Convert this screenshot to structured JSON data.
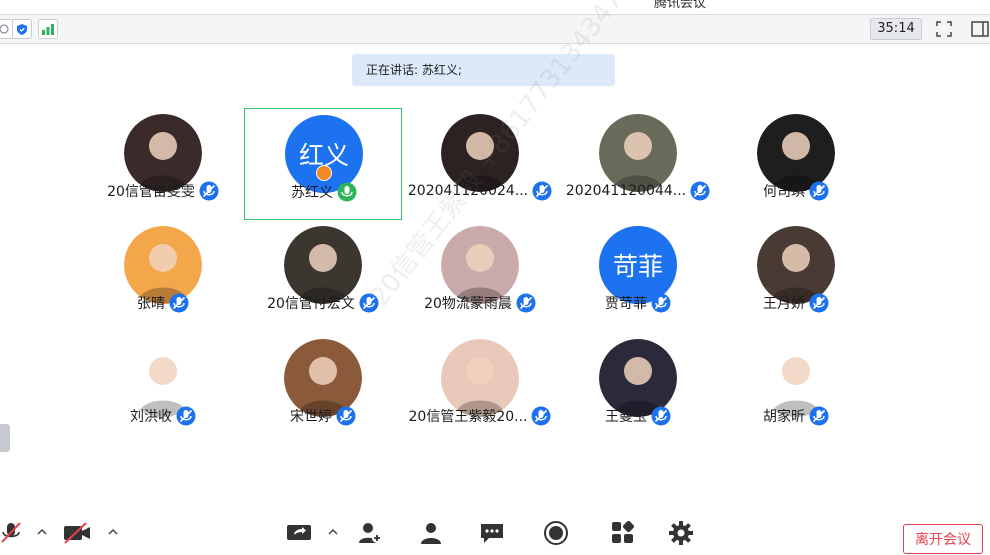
{
  "window": {
    "title": "腾讯会议"
  },
  "topbar": {
    "timer": "35:14"
  },
  "speaking_banner": {
    "text": "正在讲话: 苏红义;"
  },
  "participants": [
    {
      "name": "20信管苗雯雯",
      "avatar_type": "photo",
      "avatar_color": "#3a2a2a"
    },
    {
      "name": "苏红义",
      "avatar_type": "text",
      "avatar_text": "红义",
      "avatar_color": "#1d72f0",
      "speaking": true,
      "host": true
    },
    {
      "name": "202041120024...",
      "avatar_type": "photo",
      "avatar_color": "#2c2222"
    },
    {
      "name": "202041120044...",
      "avatar_type": "photo",
      "avatar_color": "#6a6a5a"
    },
    {
      "name": "何司琪",
      "avatar_type": "photo",
      "avatar_color": "#1e1e1e"
    },
    {
      "name": "张晴",
      "avatar_type": "photo",
      "avatar_color": "#f3a64a"
    },
    {
      "name": "20信管付宏文",
      "avatar_type": "photo",
      "avatar_color": "#3b3630"
    },
    {
      "name": "20物流蒙雨晨",
      "avatar_type": "photo",
      "avatar_color": "#c9a9a9"
    },
    {
      "name": "贾苛菲",
      "avatar_type": "text",
      "avatar_text": "苛菲",
      "avatar_color": "#1d72f0"
    },
    {
      "name": "王月娇",
      "avatar_type": "photo",
      "avatar_color": "#4a3a34"
    },
    {
      "name": "刘洪收",
      "avatar_type": "photo",
      "avatar_color": "#ffffff"
    },
    {
      "name": "宋世婷",
      "avatar_type": "photo",
      "avatar_color": "#8a5a3a"
    },
    {
      "name": "20信管王紫毅20...",
      "avatar_type": "photo",
      "avatar_color": "#e8c8b8"
    },
    {
      "name": "王曼玉",
      "avatar_type": "photo",
      "avatar_color": "#2a2a3a"
    },
    {
      "name": "胡家昕",
      "avatar_type": "photo",
      "avatar_color": "#ffffff"
    }
  ],
  "watermark": {
    "text": "20信管王紫毅 +8617731343470"
  },
  "toolbar": {
    "items": [
      {
        "icon": "mic-muted-icon"
      },
      {
        "icon": "camera-off-icon"
      },
      {
        "icon": "share-screen-icon"
      },
      {
        "icon": "invite-icon"
      },
      {
        "icon": "members-icon"
      },
      {
        "icon": "chat-icon"
      },
      {
        "icon": "record-icon"
      },
      {
        "icon": "apps-icon"
      },
      {
        "icon": "settings-icon"
      }
    ],
    "leave_label": "离开会议"
  },
  "colors": {
    "accent": "#1d72f0",
    "speaking_border": "#3cc26a",
    "leave": "#e2434b",
    "banner": "#dbe9fb"
  }
}
